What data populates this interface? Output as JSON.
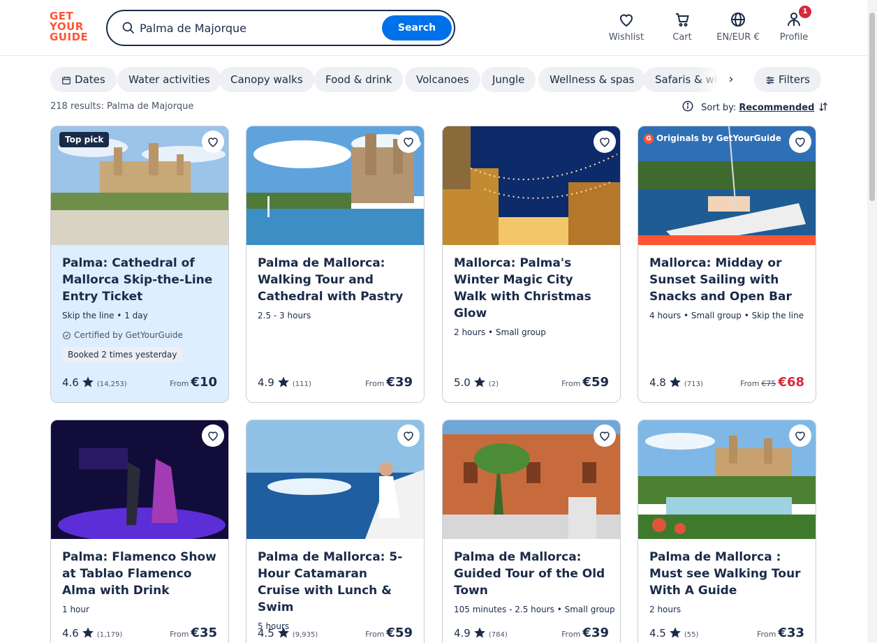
{
  "brand": {
    "logo_line1": "GET",
    "logo_line2": "YOUR",
    "logo_line3": "GUIDE",
    "color": "#ff5533"
  },
  "search": {
    "value": "Palma de Majorque",
    "button_label": "Search"
  },
  "nav": {
    "wishlist": "Wishlist",
    "cart": "Cart",
    "language": "EN/EUR €",
    "profile": "Profile",
    "profile_badge": "1"
  },
  "chips": [
    "Dates",
    "Water activities",
    "Canopy walks",
    "Food & drink",
    "Volcanoes",
    "Jungle",
    "Wellness & spas",
    "Safaris & wildlife"
  ],
  "filters_label": "Filters",
  "results": {
    "text": "218 results: Palma de Majorque"
  },
  "sort": {
    "label": "Sort by:",
    "value": "Recommended"
  },
  "cards": [
    {
      "title": "Palma: Cathedral of Mallorca Skip-the-Line Entry Ticket",
      "meta": "Skip the line • 1 day",
      "badge": "Top pick",
      "certified": "Certified by GetYourGuide",
      "booked": "Booked 2 times yesterday",
      "rating": "4.6",
      "reviews": "(14,253)",
      "from": "From",
      "price": "€10"
    },
    {
      "title": "Palma de Mallorca: Walking Tour and Cathedral with Pastry",
      "meta": "2.5 - 3 hours",
      "rating": "4.9",
      "reviews": "(111)",
      "from": "From",
      "price": "€39"
    },
    {
      "title": "Mallorca: Palma's Winter Magic City Walk with Christmas Glow",
      "meta": "2 hours • Small group",
      "rating": "5.0",
      "reviews": "(2)",
      "from": "From",
      "price": "€59"
    },
    {
      "title": "Mallorca: Midday or Sunset Sailing with Snacks and Open Bar",
      "meta": "4 hours • Small group • Skip the line",
      "originals": "Originals by GetYourGuide",
      "originals_letter": "G",
      "rating": "4.8",
      "reviews": "(713)",
      "from": "From",
      "old_price": "€75",
      "price": "€68"
    },
    {
      "title": "Palma: Flamenco Show at Tablao Flamenco Alma with Drink",
      "meta": "1 hour",
      "rating": "4.6",
      "reviews": "(1,179)",
      "from": "From",
      "price": "€35"
    },
    {
      "title": "Palma de Mallorca: 5-Hour Catamaran Cruise with Lunch & Swim",
      "meta": "5 hours",
      "rating": "4.5",
      "reviews": "(9,935)",
      "from": "From",
      "price": "€59"
    },
    {
      "title": "Palma de Mallorca: Guided Tour of the Old Town",
      "meta": "105 minutes - 2.5 hours • Small group",
      "rating": "4.9",
      "reviews": "(784)",
      "from": "From",
      "price": "€39"
    },
    {
      "title": "Palma de Mallorca : Must see Walking Tour With A Guide",
      "meta": "2 hours",
      "rating": "4.5",
      "reviews": "(55)",
      "from": "From",
      "price": "€33"
    }
  ],
  "colors": {
    "accent": "#0071eb",
    "text": "#1a2b49",
    "sale": "#d6293b",
    "highlight_card": "#ddeeff"
  }
}
